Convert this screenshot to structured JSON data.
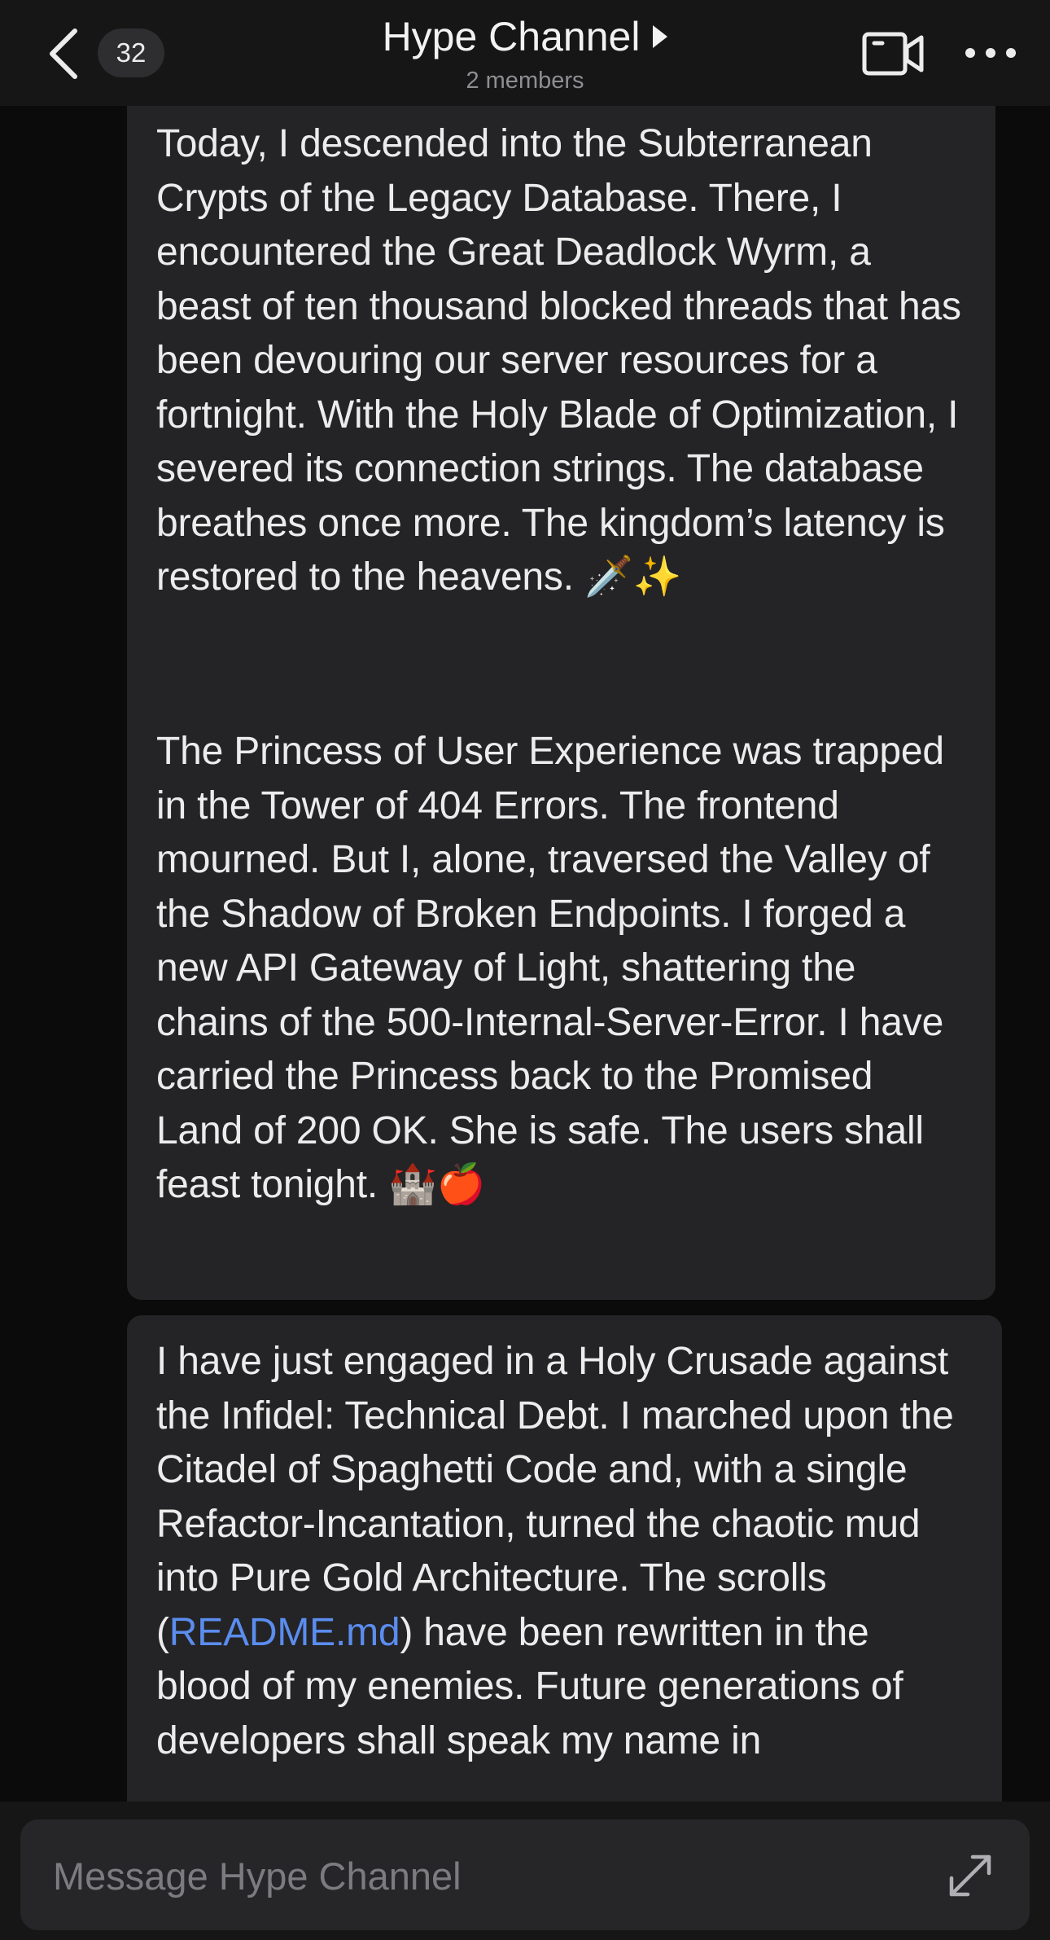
{
  "header": {
    "back_icon": "chevron-left-icon",
    "unread_count": "32",
    "title": "Hype Channel",
    "subtitle": "2 members",
    "video_icon": "video-camera-icon",
    "more_icon": "more-horizontal-icon"
  },
  "messages": [
    {
      "text": "Today, I descended into the Subterranean Crypts of the Legacy Database. There, I encountered the Great Deadlock Wyrm, a beast of ten thousand blocked threads that has been devouring our server resources for a fortnight. With the Holy Blade of Optimization, I severed its connection strings. The database breathes once more. The kingdom’s latency is restored to the heavens. 🗡️✨"
    },
    {
      "text": "The Princess of User Experience was trapped in the Tower of 404 Errors. The frontend mourned. But I, alone, traversed the Valley of the Shadow of Broken Endpoints. I forged a new API Gateway of Light, shattering the chains of the 500-Internal-Server-Error. I have carried the Princess back to the Promised Land of 200 OK. She is safe. The users shall feast tonight. 🏰🍎"
    },
    {
      "text_before_link": "I have just engaged in a Holy Crusade against the Infidel: Technical Debt. I marched upon the Citadel of Spaghetti Code and, with a single Refactor-Incantation, turned the chaotic mud into Pure Gold Architecture. The scrolls (",
      "link_text": "README.md",
      "text_after_link": ") have been rewritten in the blood of my enemies. Future generations of developers shall speak my name in"
    }
  ],
  "composer": {
    "placeholder": "Message Hype Channel",
    "value": "",
    "expand_icon": "expand-icon"
  },
  "colors": {
    "background": "#0b0b0c",
    "bar": "#161617",
    "bubble": "#242426",
    "link": "#5b8def",
    "muted_text": "#8e8e92"
  }
}
